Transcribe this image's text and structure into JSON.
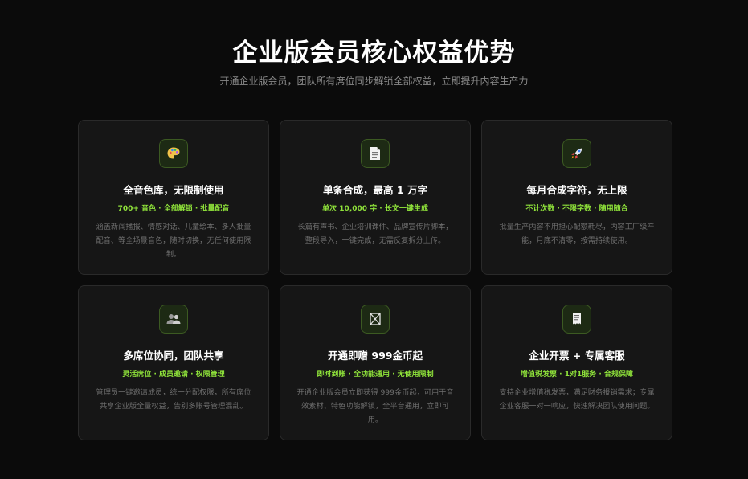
{
  "header": {
    "title": "企业版会员核心权益优势",
    "subtitle": "开通企业版会员，团队所有席位同步解锁全部权益，立即提升内容生产力"
  },
  "colors": {
    "accent": "#8fe23a",
    "card_bg": "#161616",
    "page_bg": "#0b0b0b"
  },
  "cards": [
    {
      "icon": "palette-icon",
      "title": "全音色库，无限制使用",
      "tags": "700+ 音色 · 全部解锁 · 批量配音",
      "desc": "涵盖新闻播报、情感对话、儿童绘本、多人批量配音、等全场景音色，随时切换，无任何使用限制。"
    },
    {
      "icon": "document-icon",
      "title": "单条合成，最高 1 万字",
      "tags": "单次 10,000 字 · 长文一键生成",
      "desc": "长篇有声书、企业培训课件、品牌宣传片脚本，整段导入，一键完成，无需反复拆分上传。"
    },
    {
      "icon": "rocket-icon",
      "title": "每月合成字符，无上限",
      "tags": "不计次数 · 不限字数 · 随用随合",
      "desc": "批量生产内容不用担心配额耗尽，内容工厂级产能，月底不清零，按需持续使用。"
    },
    {
      "icon": "team-icon",
      "title": "多席位协同，团队共享",
      "tags": "灵活席位 · 成员邀请 · 权限管理",
      "desc": "管理员一键邀请成员，统一分配权限，所有席位共享企业版全量权益，告别多账号管理混乱。"
    },
    {
      "icon": "gift-icon",
      "title": "开通即赠 999金币起",
      "tags": "即时到账 · 全功能通用 · 无使用限制",
      "desc": "开通企业版会员立即获得 999金币起，可用于音效素材、特色功能解锁，全平台通用，立即可用。"
    },
    {
      "icon": "invoice-icon",
      "title": "企业开票 + 专属客服",
      "tags": "增值税发票 · 1对1服务 · 合规保障",
      "desc": "支持企业增值税发票，满足财务报销需求；专属企业客服一对一响应，快速解决团队使用问题。"
    }
  ]
}
